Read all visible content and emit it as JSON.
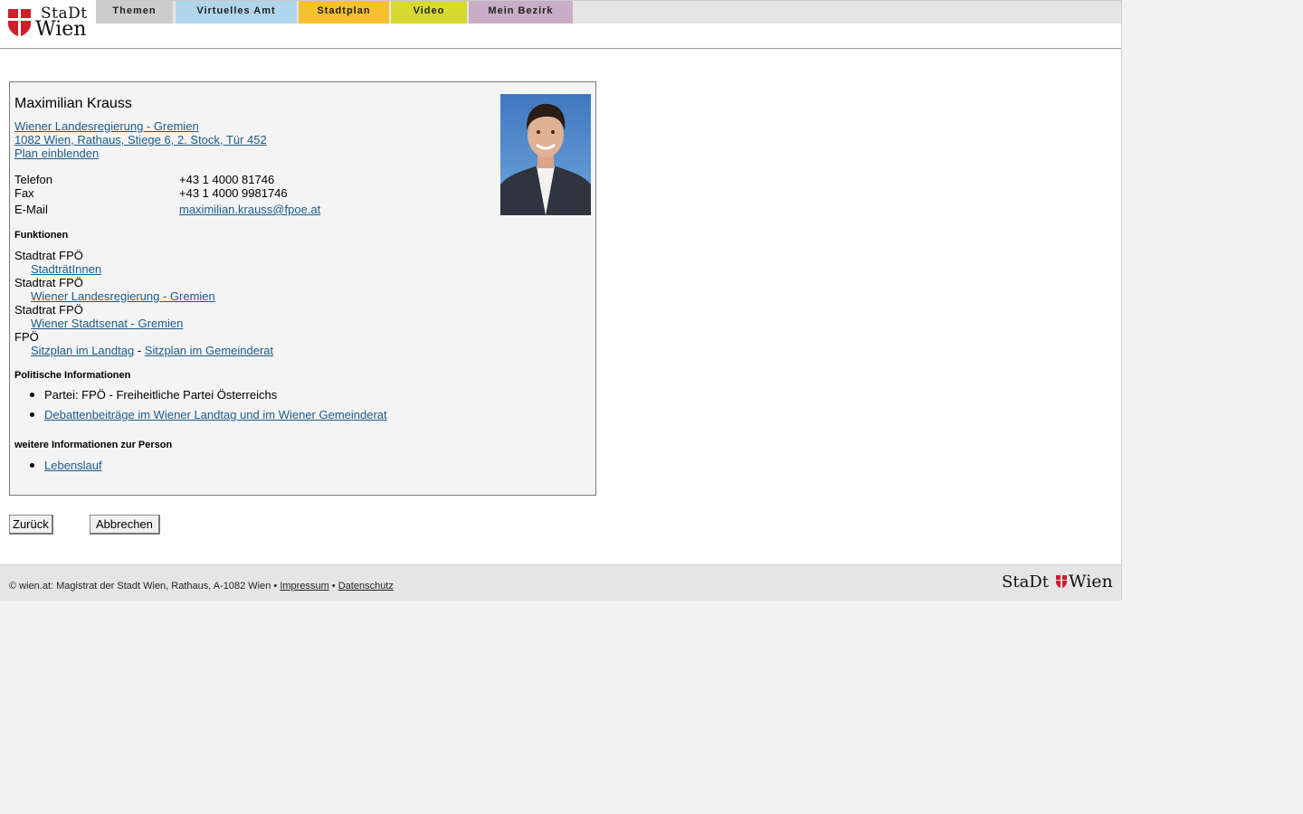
{
  "header": {
    "logo_line1": "StaDt",
    "logo_line2": "Wien",
    "tabs": [
      {
        "label": "Themen",
        "color": "#cccccc"
      },
      {
        "label": "Virtuelles Amt",
        "color": "#b0d6ee"
      },
      {
        "label": "Stadtplan",
        "color": "#f6c12e"
      },
      {
        "label": "Video",
        "color": "#d6d92f"
      },
      {
        "label": "Mein Bezirk",
        "color": "#c9acc5"
      }
    ]
  },
  "person": {
    "name": "Maximilian Krauss",
    "org_link": "Wiener Landesregierung - Gremien",
    "address_link": "1082 Wien, Rathaus, Stiege 6, 2. Stock, Tür 452",
    "map_link": "Plan einblenden",
    "contact": [
      {
        "label": "Telefon",
        "value": "+43 1 4000 81746"
      },
      {
        "label": "Fax",
        "value": "+43 1 4000 9981746"
      },
      {
        "label": "E-Mail",
        "value": "maximilian.krauss@fpoe.at"
      }
    ]
  },
  "functions": {
    "heading": "Funktionen",
    "items": [
      {
        "role": "Stadtrat FPÖ",
        "link": "StadträtInnen"
      },
      {
        "role": "Stadtrat FPÖ",
        "link": "Wiener Landesregierung - Gremien"
      },
      {
        "role": "Stadtrat FPÖ",
        "link": "Wiener Stadtsenat - Gremien"
      }
    ],
    "party_role": "FPÖ",
    "seat_link1": "Sitzplan im Landtag",
    "seat_sep": "-",
    "seat_link2": "Sitzplan im Gemeinderat"
  },
  "political": {
    "heading": "Politische Informationen",
    "party": "Partei: FPÖ - Freiheitliche Partei Österreichs",
    "debates_link": "Debattenbeiträge im Wiener Landtag und im Wiener Gemeinderat"
  },
  "more": {
    "heading": "weitere Informationen zur Person",
    "cv_link": "Lebenslauf"
  },
  "buttons": {
    "back": "Zurück",
    "cancel": "Abbrechen"
  },
  "footer": {
    "text": "© wien.at: Magistrat der Stadt Wien, Rathaus, A-1082 Wien •",
    "impressum": "Impressum",
    "sep": "•",
    "datenschutz": "Datenschutz",
    "logo_a": "StaDt",
    "logo_b": "Wien"
  }
}
